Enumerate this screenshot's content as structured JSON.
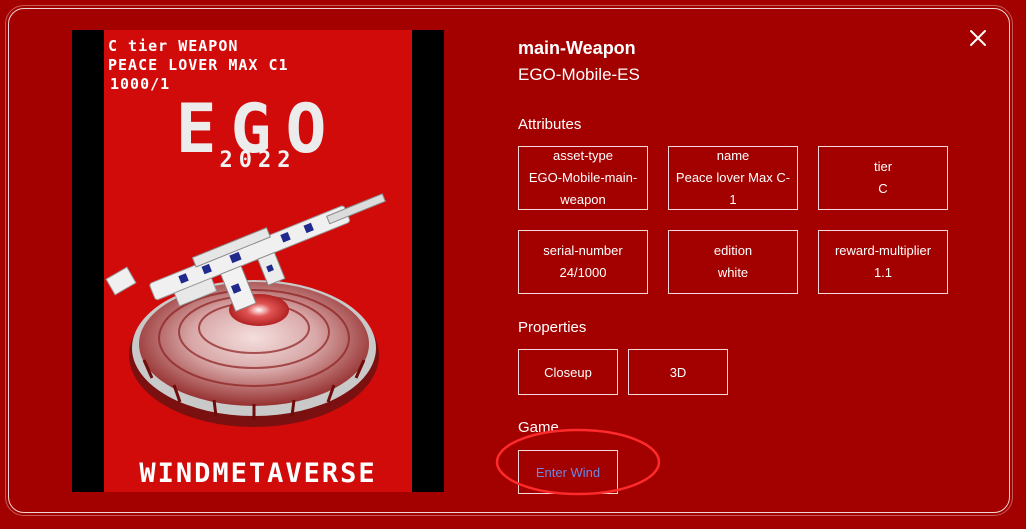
{
  "asset": {
    "title": "main-Weapon",
    "collection": "EGO-Mobile-ES"
  },
  "artwork": {
    "line1": "C tier WEAPON",
    "line2": "PEACE LOVER MAX C1",
    "line3": "1000/1",
    "big": "EGO",
    "year": "2022",
    "footer": "WINDMETAVERSE"
  },
  "attributes": {
    "label": "Attributes",
    "items": [
      {
        "key": "asset-type",
        "value": "EGO-Mobile-main-weapon"
      },
      {
        "key": "name",
        "value": "Peace lover Max C-1"
      },
      {
        "key": "tier",
        "value": "C"
      },
      {
        "key": "serial-number",
        "value": "24/1000"
      },
      {
        "key": "edition",
        "value": "white"
      },
      {
        "key": "reward-multiplier",
        "value": "1.1"
      }
    ]
  },
  "properties": {
    "label": "Properties",
    "buttons": [
      "Closeup",
      "3D"
    ]
  },
  "game": {
    "label": "Game",
    "button": "Enter Wind"
  },
  "colors": {
    "background": "#a30000",
    "art_background": "#d10a0a",
    "link": "#6f86e0",
    "annotation": "#ff2a2a"
  },
  "icons": {
    "close": "close-icon"
  }
}
